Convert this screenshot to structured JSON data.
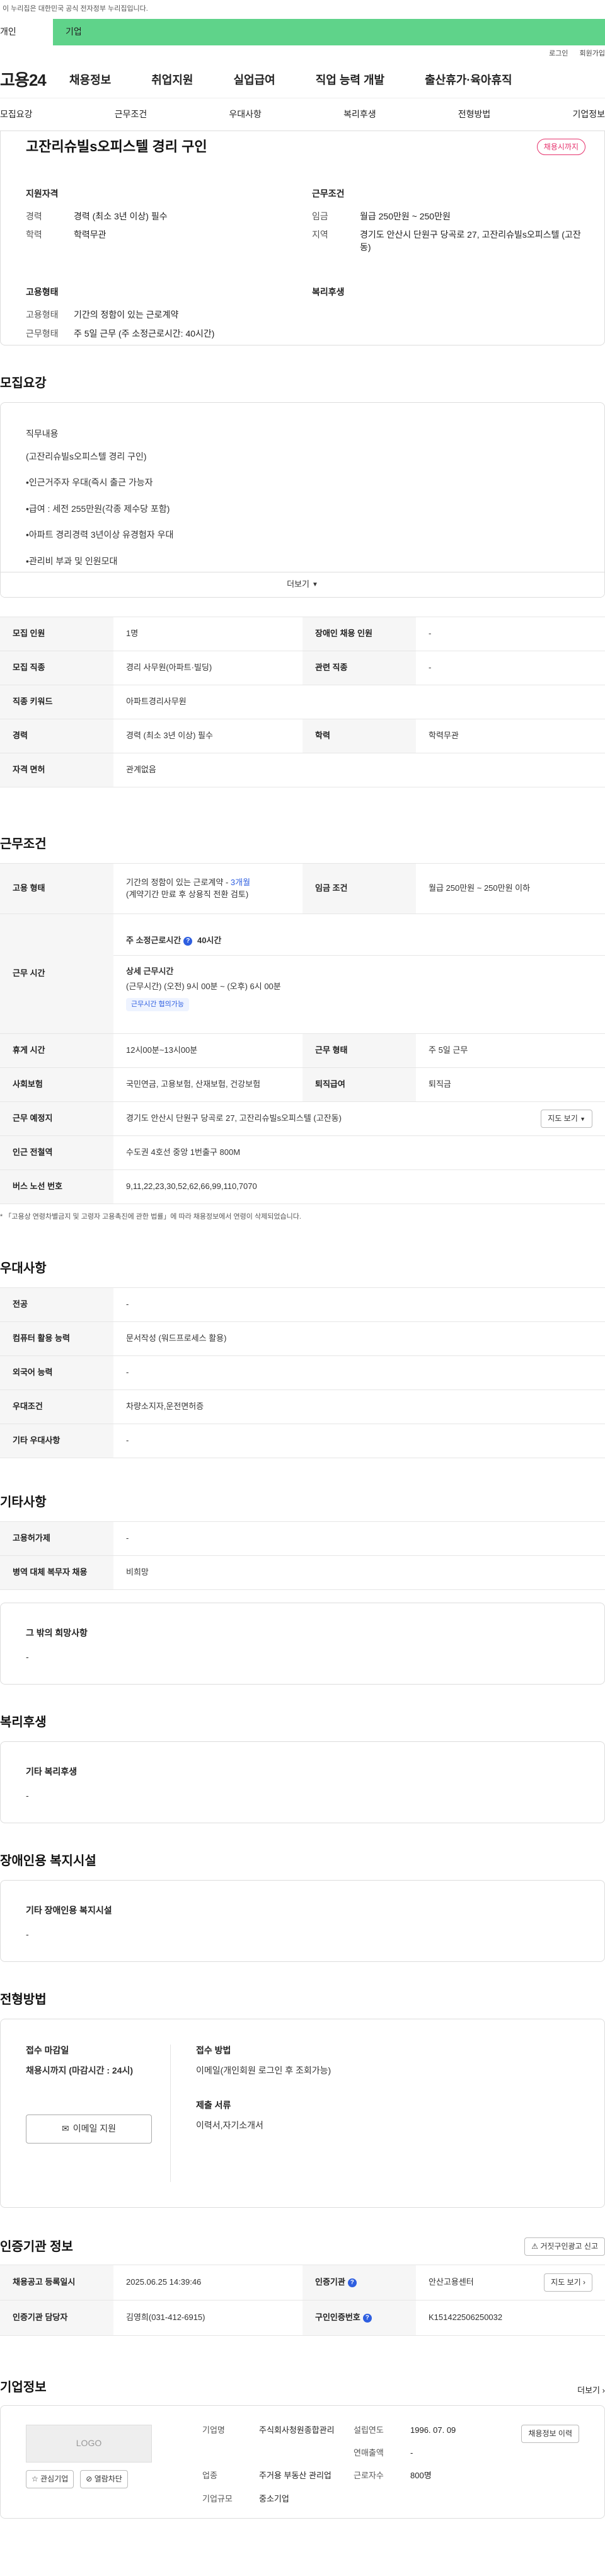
{
  "gov_notice": "이 누리집은 대한민국 공식 전자정부 누리집입니다.",
  "gov_tabs": [
    "개인",
    "기업"
  ],
  "util": [
    "로그인",
    "회원가입"
  ],
  "brand": "고용24",
  "gnb": [
    "채용정보",
    "취업지원",
    "실업급여",
    "직업 능력 개발",
    "출산휴가·육아휴직"
  ],
  "anchor_tabs": [
    "모집요강",
    "근무조건",
    "우대사항",
    "복리후생",
    "전형방법",
    "기업정보"
  ],
  "summary": {
    "title": "고잔리슈빌s오피스텔 경리 구인",
    "badge": "채용시까지",
    "sections": {
      "qual": {
        "title": "지원자격",
        "rows": [
          {
            "k": "경력",
            "v": "경력 (최소 3년 이상) 필수"
          },
          {
            "k": "학력",
            "v": "학력무관"
          }
        ]
      },
      "cond": {
        "title": "근무조건",
        "rows": [
          {
            "k": "임금",
            "v": "월급 250만원 ~ 250만원"
          },
          {
            "k": "지역",
            "v": "경기도 안산시 단원구 당곡로 27, 고잔리슈빌s오피스텔 (고잔동)"
          }
        ]
      },
      "emp": {
        "title": "고용형태",
        "rows": [
          {
            "k": "고용형태",
            "v": "기간의 정함이 있는 근로계약"
          },
          {
            "k": "근무형태",
            "v": "주 5일 근무 (주 소정근로시간: 40시간)"
          }
        ]
      },
      "welfare": {
        "title": "복리후생"
      }
    }
  },
  "recruit": {
    "title": "모집요강",
    "job_content_label": "직무내용",
    "job_lines": [
      "(고잔리슈빌s오피스텔 경리 구인)",
      "•인근거주자 우대(즉시 출근 가능자",
      "•급여 : 세전 255만원(각종 제수당 포함)",
      "•아파트 경리경력 3년이상 유경험자 우대",
      "•관리비 부과 및 인원모대"
    ],
    "more": "더보기",
    "table": [
      {
        "k1": "모집 인원",
        "v1": "1명",
        "k2": "장애인 채용 인원",
        "v2": "-"
      },
      {
        "k1": "모집 직종",
        "v1": "경리 사무원(아파트·빌딩)",
        "k2": "관련 직종",
        "v2": "-"
      },
      {
        "k1": "직종 키워드",
        "v1": "아파트경리사무원"
      },
      {
        "k1": "경력",
        "v1": "경력 (최소 3년 이상) 필수",
        "k2": "학력",
        "v2": "학력무관"
      },
      {
        "k1": "자격 면허",
        "v1": "관계없음"
      }
    ]
  },
  "work": {
    "title": "근무조건",
    "emp_type_k": "고용 형태",
    "emp_type_v1": "기간의 정함이 있는 근로계약 - ",
    "emp_type_v1b": "3개월",
    "emp_type_v2": "(계약기간 만료 후 상용직 전환 검토)",
    "wage_k": "임금 조건",
    "wage_v": "월급 250만원 ~ 250만원 이하",
    "hours_k": "근무 시간",
    "hours_week": "주 소정근로시간",
    "hours_week_v": "40시간",
    "hours_detail_t": "상세 근무시간",
    "hours_detail_v": "(근무시간) (오전) 9시 00분 ~ (오후) 6시 00분",
    "hours_tag": "근무시간 협의가능",
    "break_k": "휴게 시간",
    "break_v": "12시00분~13시00분",
    "form_k": "근무 형태",
    "form_v": "주 5일 근무",
    "ins_k": "사회보험",
    "ins_v": "국민연금, 고용보험, 산재보험, 건강보험",
    "sev_k": "퇴직급여",
    "sev_v": "퇴직금",
    "place_k": "근무 예정지",
    "place_v": "경기도 안산시 단원구 당곡로 27, 고잔리슈빌s오피스텔 (고잔동)",
    "map_btn": "지도 보기",
    "station_k": "인근 전철역",
    "station_v": "수도권 4호선 중앙 1번출구 800M",
    "bus_k": "버스 노선 번호",
    "bus_v": "9,11,22,23,30,52,62,66,99,110,7070",
    "note": "* 「고용상 연령차별금지 및 고령자 고용촉진에 관한 법률」에 따라 채용정보에서 연령이 삭제되었습니다."
  },
  "pref": {
    "title": "우대사항",
    "rows": [
      {
        "k": "전공",
        "v": "-"
      },
      {
        "k": "컴퓨터 활용 능력",
        "v": "문서작성 (워드프로세스 활용)"
      },
      {
        "k": "외국어 능력",
        "v": "-"
      },
      {
        "k": "우대조건",
        "v": "차량소지자,운전면허증"
      },
      {
        "k": "기타 우대사항",
        "v": "-"
      }
    ]
  },
  "etc": {
    "title": "기타사항",
    "rows": [
      {
        "k": "고용허가제",
        "v": "-"
      },
      {
        "k": "병역 대체 복무자 채용",
        "v": "비희망"
      }
    ],
    "box_t": "그 밖의 희망사항",
    "box_v": "-"
  },
  "welfare": {
    "title": "복리후생",
    "box_t": "기타 복리후생",
    "box_v": "-"
  },
  "disabled": {
    "title": "장애인용 복지시설",
    "box_t": "기타 장애인용 복지시설",
    "box_v": "-"
  },
  "apply": {
    "title": "전형방법",
    "deadline_t": "접수 마감일",
    "deadline_v": "채용시까지 (마감시간 : 24시)",
    "email_btn": "이메일 지원",
    "method_t": "접수 방법",
    "method_v": "이메일(개인회원 로그인 후 조회가능)",
    "docs_t": "제출 서류",
    "docs_v": "이력서,자기소개서"
  },
  "agency": {
    "title": "인증기관 정보",
    "report_btn": "거짓구인광고 신고",
    "reg_k": "채용공고 등록일시",
    "reg_v": "2025.06.25 14:39:46",
    "org_k": "인증기관",
    "org_v": "안산고용센터",
    "map_btn": "지도 보기",
    "mgr_k": "인증기관 담당자",
    "mgr_v": "김영희(031-412-6915)",
    "num_k": "구인인증번호",
    "num_v": "K151422506250032"
  },
  "company": {
    "title": "기업정보",
    "more": "더보기",
    "logo": "LOGO",
    "fav_btn": "관심기업",
    "block_btn": "열람차단",
    "info_btn": "채용정보 이력",
    "name_k": "기업명",
    "name_v": "주식회사청원종합관리",
    "found_k": "설립연도",
    "found_v": "1996. 07. 09",
    "sales_k": "연매출액",
    "sales_v": "-",
    "ind_k": "업종",
    "ind_v": "주거용 부동산 관리업",
    "emp_k": "근로자수",
    "emp_v": "800명",
    "size_k": "기업규모",
    "size_v": "중소기업"
  }
}
